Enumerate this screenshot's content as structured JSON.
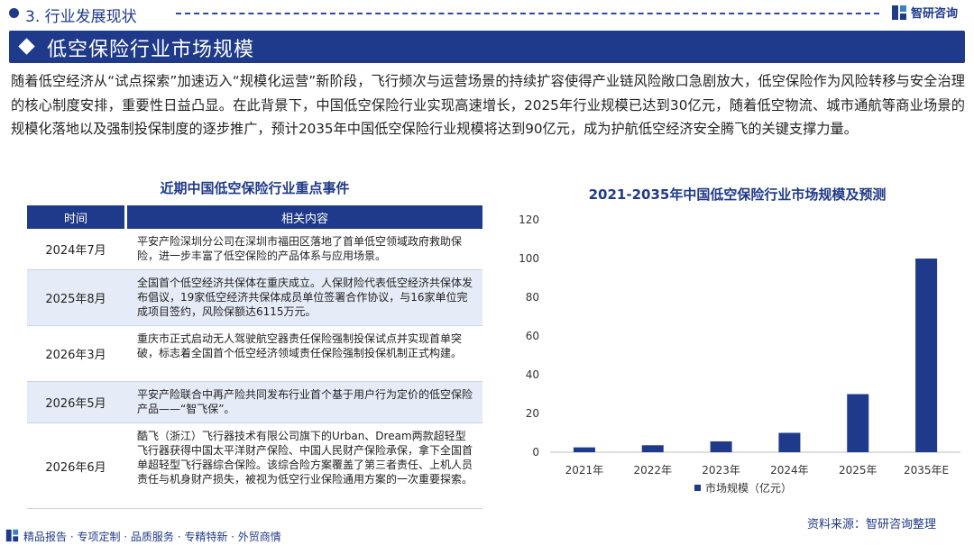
{
  "header": {
    "section": "3. 行业发展现状",
    "brand": "智研咨询"
  },
  "banner": {
    "title": "低空保险行业市场规模"
  },
  "intro": "随着低空经济从“试点探索”加速迈入“规模化运营”新阶段，飞行频次与运营场景的持续扩容使得产业链风险敞口急剧放大，低空保险作为风险转移与安全治理的核心制度安排，重要性日益凸显。在此背景下，中国低空保险行业实现高速增长，2025年行业规模已达到30亿元，随着低空物流、城市通航等商业场景的规模化落地以及强制投保制度的逐步推广，预计2035年中国低空保险行业规模将达到90亿元，成为护航低空经济安全腾飞的关键支撑力量。",
  "table": {
    "title": "近期中国低空保险行业重点事件",
    "col_time": "时间",
    "col_content": "相关内容",
    "rows": [
      {
        "time": "2024年7月",
        "content": "平安产险深圳分公司在深圳市福田区落地了首单低空领域政府救助保险，进一步丰富了低空保险的产品体系与应用场景。"
      },
      {
        "time": "2025年8月",
        "content": "全国首个低空经济共保体在重庆成立。人保财险代表低空经济共保体发布倡议，19家低空经济共保体成员单位签署合作协议，与16家单位完成项目签约，风险保额达6115万元。"
      },
      {
        "time": "2026年3月",
        "content": "重庆市正式启动无人驾驶航空器责任保险强制投保试点并实现首单突破，标志着全国首个低空经济领域责任保险强制投保机制正式构建。"
      },
      {
        "time": "2026年5月",
        "content": "平安产险联合中再产险共同发布行业首个基于用户行为定价的低空保险产品——“智飞保”。"
      },
      {
        "time": "2026年6月",
        "content": "酷飞（浙江）飞行器技术有限公司旗下的Urban、Dream两款超轻型飞行器获得中国太平洋财产保险、中国人民财产保险承保，拿下全国首单超轻型飞行器综合保险。该综合险方案覆盖了第三者责任、上机人员责任与机身财产损失，被视为低空行业保险通用方案的一次重要探索。"
      }
    ]
  },
  "chart_data": {
    "type": "bar",
    "title": "2021-2035年中国低空保险行业市场规模及预测",
    "categories": [
      "2021年",
      "2022年",
      "2023年",
      "2024年",
      "2025年",
      "2035年E"
    ],
    "series": [
      {
        "name": "市场规模（亿元）",
        "values": [
          2.5,
          3.6,
          5.6,
          10,
          30,
          100
        ],
        "color": "#1f3a8a"
      }
    ],
    "ylim": [
      0,
      120
    ],
    "yticks": [
      0,
      20,
      40,
      60,
      80,
      100,
      120
    ],
    "grid": false,
    "legend": "bottom"
  },
  "source": "资料来源：智研咨询整理",
  "footer": "精品报告 · 专项定制 · 品质服务 · 专精特新 · 外贸商情"
}
